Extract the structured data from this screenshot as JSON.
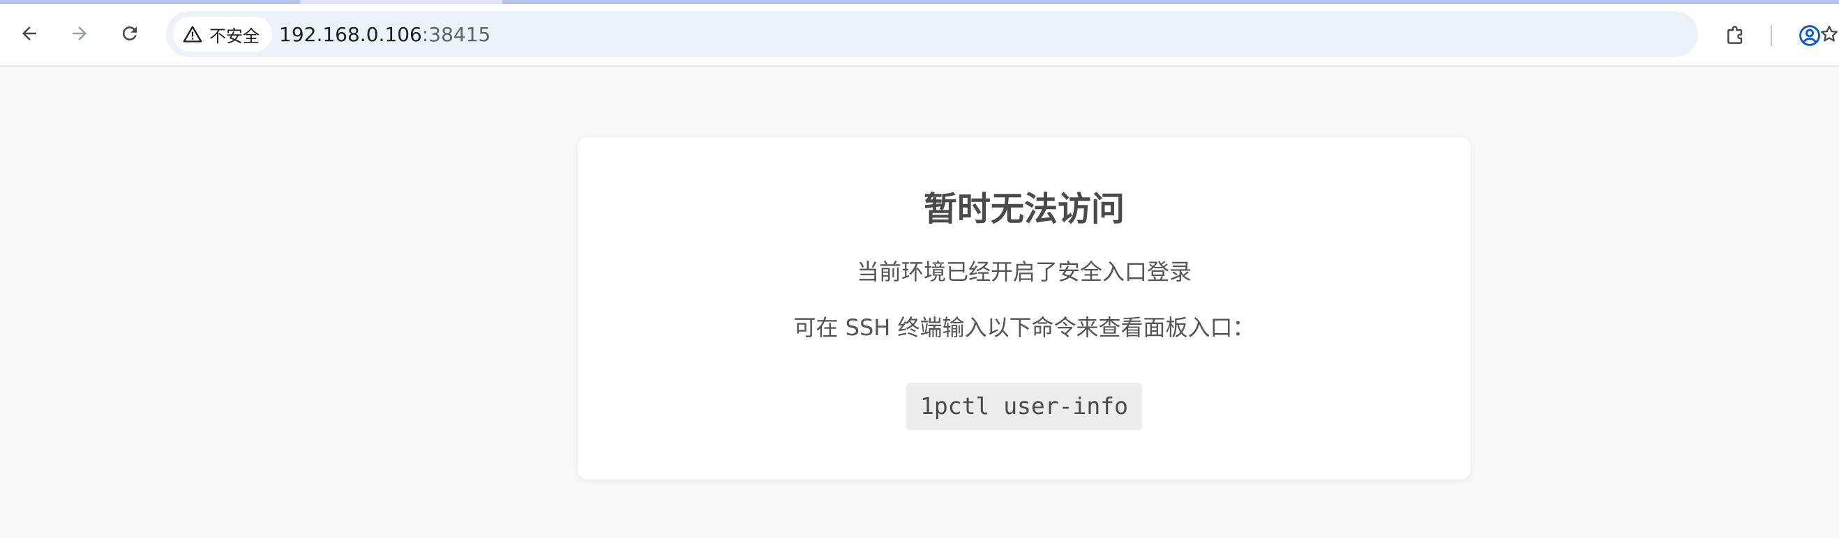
{
  "browser": {
    "security_label": "不安全",
    "url_host": "192.168.0.106",
    "url_port": ":38415",
    "icons": {
      "back": "arrow-left-icon",
      "forward": "arrow-right-icon",
      "reload": "reload-icon",
      "warning": "warning-triangle-icon",
      "bookmark": "star-icon",
      "extensions": "puzzle-icon",
      "profile": "account-circle-icon"
    },
    "colors": {
      "omnibox_bg": "#edf2fa",
      "profile_accent": "#0b57d0"
    }
  },
  "page": {
    "title": "暂时无法访问",
    "message": "当前环境已经开启了安全入口登录",
    "hint": "可在 SSH 终端输入以下命令来查看面板入口：",
    "command": "1pctl user-info"
  }
}
